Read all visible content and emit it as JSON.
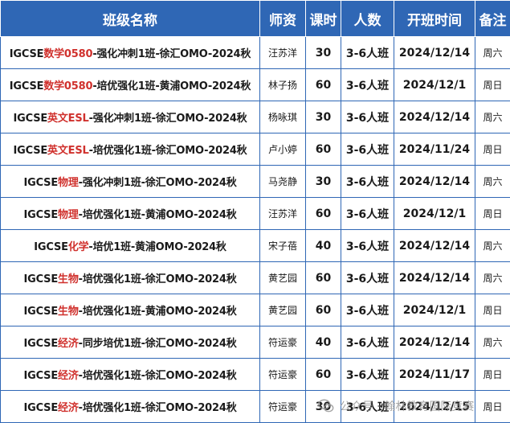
{
  "headers": [
    "班级名称",
    "师资",
    "课时",
    "人数",
    "开班时间",
    "备注"
  ],
  "colors": {
    "header_bg": "#2f67b5",
    "subject_red": "#d0312d",
    "border": "#2f67b5"
  },
  "rows": [
    {
      "prefix": "IGCSE",
      "subject": "数学0580",
      "suffix": "-强化冲刺1班-徐汇OMO-2024秋",
      "teacher": "汪苏洋",
      "hours": "30",
      "size": "3-6人班",
      "start": "2024/12/14",
      "note": "周六"
    },
    {
      "prefix": "IGCSE",
      "subject": "数学0580",
      "suffix": "-培优强化1班-黄浦OMO-2024秋",
      "teacher": "林子扬",
      "hours": "60",
      "size": "3-6人班",
      "start": "2024/12/1",
      "note": "周日"
    },
    {
      "prefix": "IGCSE",
      "subject": "英文ESL",
      "suffix": "-强化冲刺1班-徐汇OMO-2024秋",
      "teacher": "杨咏琪",
      "hours": "30",
      "size": "3-6人班",
      "start": "2024/12/14",
      "note": "周六"
    },
    {
      "prefix": "IGCSE",
      "subject": "英文ESL",
      "suffix": "-培优强化1班-徐汇OMO-2024秋",
      "teacher": "卢小婷",
      "hours": "60",
      "size": "3-6人班",
      "start": "2024/11/24",
      "note": "周日"
    },
    {
      "prefix": "IGCSE",
      "subject": "物理",
      "suffix": "-强化冲刺1班-徐汇OMO-2024秋",
      "teacher": "马尧静",
      "hours": "30",
      "size": "3-6人班",
      "start": "2024/12/14",
      "note": "周六"
    },
    {
      "prefix": "IGCSE",
      "subject": "物理",
      "suffix": "-培优强化1班-黄浦OMO-2024秋",
      "teacher": "汪苏洋",
      "hours": "60",
      "size": "3-6人班",
      "start": "2024/12/1",
      "note": "周日"
    },
    {
      "prefix": "IGCSE",
      "subject": "化学",
      "suffix": "-培优1班-黄浦OMO-2024秋",
      "teacher": "宋子蓓",
      "hours": "40",
      "size": "3-6人班",
      "start": "2024/12/14",
      "note": "周六"
    },
    {
      "prefix": "IGCSE",
      "subject": "生物",
      "suffix": "-培优强化1班-徐汇OMO-2024秋",
      "teacher": "黄艺园",
      "hours": "60",
      "size": "3-6人班",
      "start": "2024/12/14",
      "note": "周六"
    },
    {
      "prefix": "IGCSE",
      "subject": "生物",
      "suffix": "-培优强化1班-黄浦OMO-2024秋",
      "teacher": "黄艺园",
      "hours": "60",
      "size": "3-6人班",
      "start": "2024/12/1",
      "note": "周日"
    },
    {
      "prefix": "IGCSE",
      "subject": "经济",
      "suffix": "-同步培优1班-徐汇OMO-2024秋",
      "teacher": "符运豪",
      "hours": "40",
      "size": "3-6人班",
      "start": "2024/12/14",
      "note": "周六"
    },
    {
      "prefix": "IGCSE",
      "subject": "经济",
      "suffix": "-培优强化1班-徐汇OMO-2024秋",
      "teacher": "符运豪",
      "hours": "60",
      "size": "3-6人班",
      "start": "2024/11/17",
      "note": "周日"
    },
    {
      "prefix": "IGCSE",
      "subject": "经济",
      "suffix": "-培优强化1班-徐汇OMO-2024秋",
      "teacher": "符运豪",
      "hours": "30",
      "size": "3-6人班",
      "start": "2024/12/15",
      "note": "周日"
    }
  ],
  "watermark": {
    "text": "公众号 · 翰林教育国际竞赛",
    "icon": "wechat-icon"
  }
}
